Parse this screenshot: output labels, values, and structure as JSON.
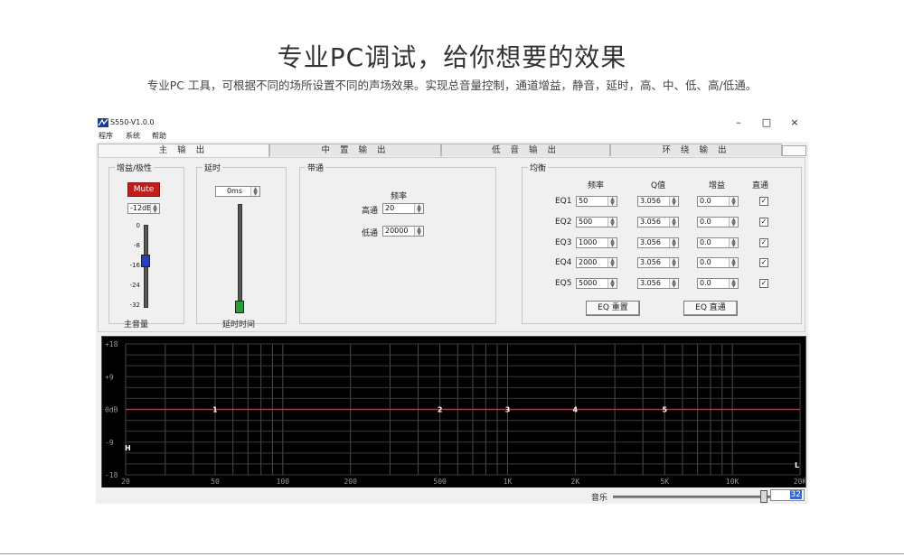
{
  "headline": "专业PC调试，给你想要的效果",
  "subline": "专业PC 工具，可根据不同的场所设置不同的声场效果。实现总音量控制，通道增益，静音，延时，高、中、低、高/低通。",
  "window": {
    "title": "S550-V1.0.0",
    "minimize": "–",
    "maximize": "□",
    "close": "×"
  },
  "menu": [
    "程序",
    "系统",
    "帮助"
  ],
  "tabs": [
    "主 输 出",
    "中 置 输 出",
    "低 音 输 出",
    "环 绕 输 出"
  ],
  "gain": {
    "legend": "增益/极性",
    "mute_label": "Mute",
    "value": "-12dB",
    "ticks": [
      "0",
      "-8",
      "-16",
      "-24",
      "-32"
    ],
    "caption": "主音量",
    "level_db": -12
  },
  "delay": {
    "legend": "延时",
    "value": "0ms",
    "caption": "延时时间",
    "level": 0
  },
  "bandpass": {
    "legend": "带通",
    "freq_header": "频率",
    "high_label": "高通",
    "high_value": "20",
    "low_label": "低通",
    "low_value": "20000"
  },
  "eq": {
    "legend": "均衡",
    "headers": [
      "频率",
      "Q值",
      "增益",
      "直通"
    ],
    "rows": [
      {
        "label": "EQ1",
        "freq": "50",
        "q": "3.056",
        "gain": "0.0",
        "through": true
      },
      {
        "label": "EQ2",
        "freq": "500",
        "q": "3.056",
        "gain": "0.0",
        "through": true
      },
      {
        "label": "EQ3",
        "freq": "1000",
        "q": "3.056",
        "gain": "0.0",
        "through": true
      },
      {
        "label": "EQ4",
        "freq": "2000",
        "q": "3.056",
        "gain": "0.0",
        "through": true
      },
      {
        "label": "EQ5",
        "freq": "5000",
        "q": "3.056",
        "gain": "0.0",
        "through": true
      }
    ],
    "reset_label": "EQ 重置",
    "through_label": "EQ 直通"
  },
  "graph": {
    "y_labels": [
      "+18",
      "+9",
      "0dB",
      "-9",
      "-18"
    ],
    "y_values": [
      18,
      9,
      0,
      -9,
      -18
    ],
    "x_labels": [
      "20",
      "50",
      "100",
      "200",
      "500",
      "1K",
      "2K",
      "5K",
      "10K",
      "20K"
    ],
    "x_values": [
      20,
      50,
      100,
      200,
      500,
      1000,
      2000,
      5000,
      10000,
      20000
    ],
    "points": [
      {
        "label": "1",
        "freq": 50
      },
      {
        "label": "2",
        "freq": 500
      },
      {
        "label": "3",
        "freq": 1000
      },
      {
        "label": "4",
        "freq": 2000
      },
      {
        "label": "5",
        "freq": 5000
      }
    ],
    "marker_h": "H",
    "marker_l": "L",
    "curve_color": "#e8202a"
  },
  "status": {
    "music_label": "音乐",
    "music_value": "32"
  }
}
